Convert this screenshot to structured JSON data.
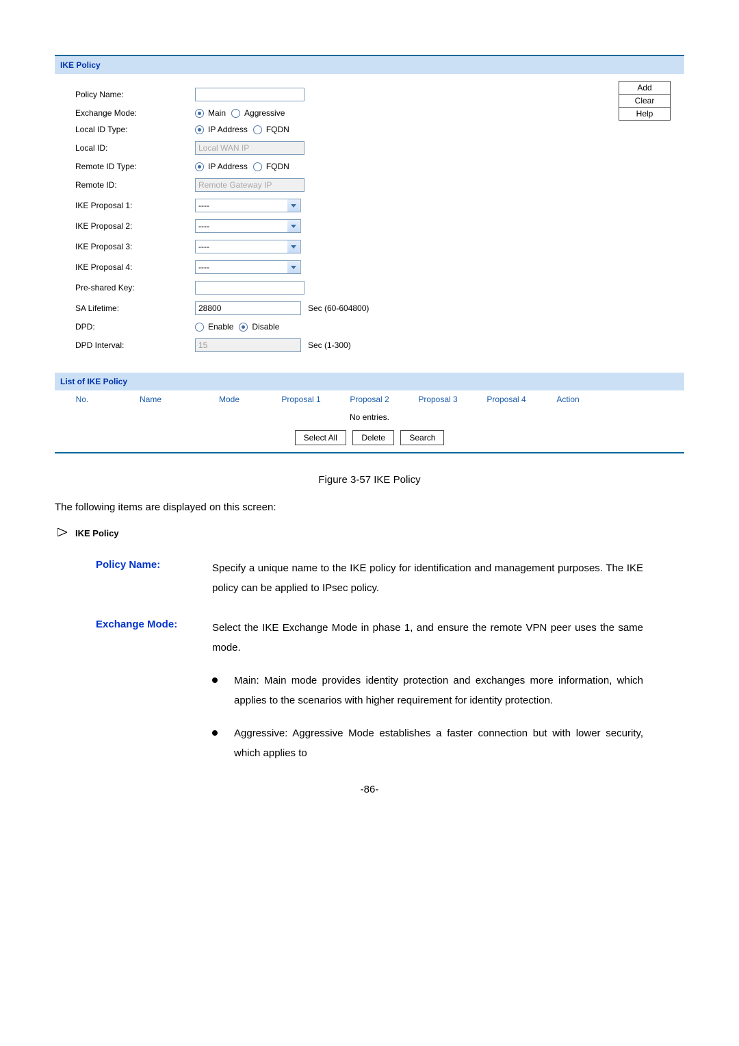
{
  "panel": {
    "section1_title": "IKE Policy",
    "section2_title": "List of IKE Policy",
    "labels": {
      "policy_name": "Policy Name:",
      "exchange_mode": "Exchange Mode:",
      "local_id_type": "Local ID Type:",
      "local_id": "Local ID:",
      "remote_id_type": "Remote ID Type:",
      "remote_id": "Remote ID:",
      "ike_proposal_1": "IKE Proposal 1:",
      "ike_proposal_2": "IKE Proposal 2:",
      "ike_proposal_3": "IKE Proposal 3:",
      "ike_proposal_4": "IKE Proposal 4:",
      "pre_shared_key": "Pre-shared Key:",
      "sa_lifetime": "SA Lifetime:",
      "dpd": "DPD:",
      "dpd_interval": "DPD Interval:"
    },
    "values": {
      "policy_name": "",
      "local_id_placeholder": "Local WAN IP",
      "remote_id_placeholder": "Remote Gateway IP",
      "proposal_text": "----",
      "pre_shared_key": "",
      "sa_lifetime": "28800",
      "sa_lifetime_suffix": "Sec (60-604800)",
      "dpd_interval": "15",
      "dpd_interval_suffix": "Sec (1-300)"
    },
    "radios": {
      "main": "Main",
      "aggressive": "Aggressive",
      "ip_address": "IP Address",
      "fqdn": "FQDN",
      "enable": "Enable",
      "disable": "Disable"
    },
    "buttons": {
      "add": "Add",
      "clear": "Clear",
      "help": "Help",
      "select_all": "Select All",
      "delete": "Delete",
      "search": "Search"
    },
    "table": {
      "headers": [
        "No.",
        "Name",
        "Mode",
        "Proposal 1",
        "Proposal 2",
        "Proposal 3",
        "Proposal 4",
        "Action"
      ],
      "no_entries": "No entries."
    }
  },
  "doc": {
    "figure_caption": "Figure 3-57 IKE Policy",
    "intro": "The following items are displayed on this screen:",
    "section_title": "IKE Policy",
    "policy_name_label": "Policy Name:",
    "policy_name_desc": "Specify a unique name to the IKE policy for identification and management purposes. The IKE policy can be applied to IPsec policy.",
    "exchange_mode_label": "Exchange Mode:",
    "exchange_mode_desc": "Select the IKE Exchange Mode in phase 1, and ensure the remote VPN peer uses the same mode.",
    "bullet_main": "Main: Main mode provides identity protection and exchanges more information, which applies to the scenarios with higher requirement for identity protection.",
    "bullet_aggressive": "Aggressive: Aggressive Mode establishes a faster connection but with lower security, which applies to",
    "page_number": "-86-"
  }
}
